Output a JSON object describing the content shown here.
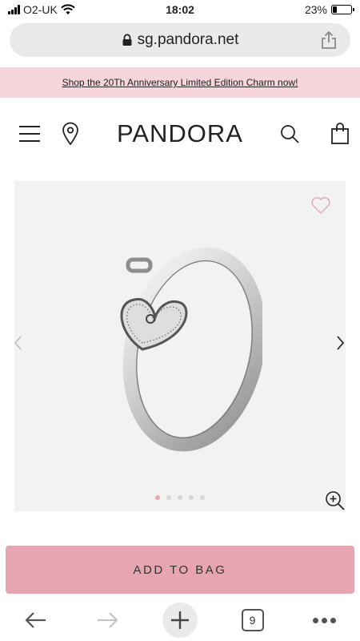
{
  "status_bar": {
    "carrier": "O2-UK",
    "time": "18:02",
    "battery": "23%",
    "battery_level": 0.23
  },
  "browser": {
    "url": "sg.pandora.net",
    "tab_count": "9"
  },
  "promo": {
    "text": "Shop the 20Th Anniversary Limited Edition Charm now!"
  },
  "header": {
    "logo": "PANDORA"
  },
  "gallery": {
    "slide_count": 5,
    "active_slide": 1
  },
  "actions": {
    "add_to_bag": "ADD TO BAG"
  },
  "colors": {
    "promo_bg": "#f6d5dc",
    "add_to_bag_bg": "#e6a5b1",
    "heart": "#e8a9b4"
  }
}
